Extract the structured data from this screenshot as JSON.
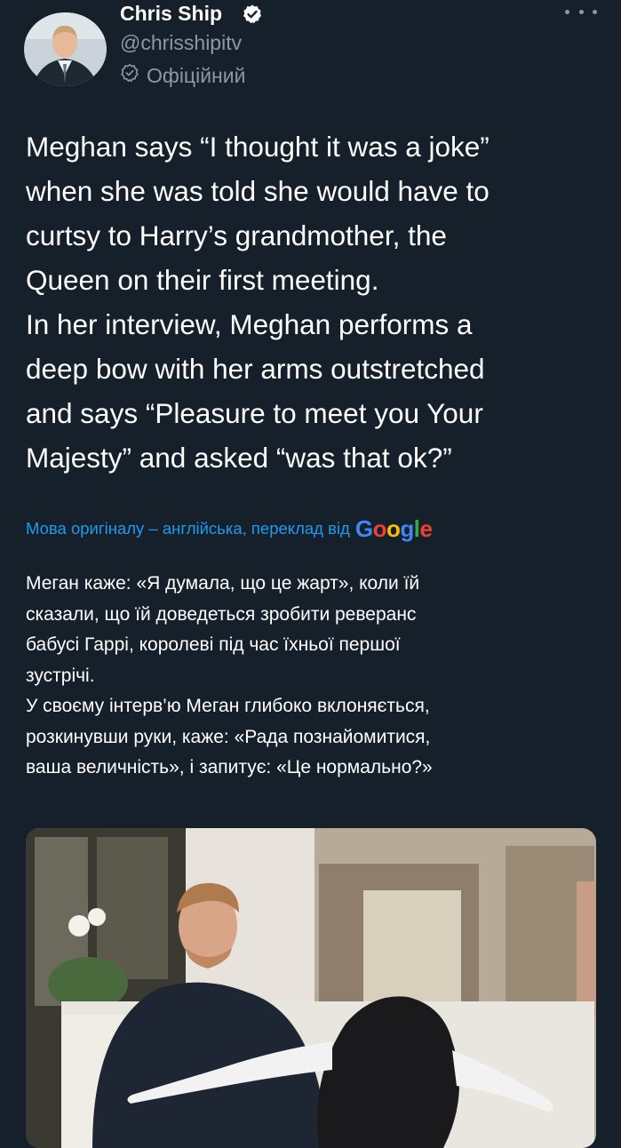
{
  "author": {
    "name": "Chris Ship",
    "handle": "@chrisshipitv",
    "official_label": "Офіційний",
    "verified_icon": "verified-badge-icon"
  },
  "tweet": {
    "lines": [
      "Meghan says “I thought it was a joke”",
      "when she was told she would have to",
      "curtsy to Harry’s grandmother, the",
      "Queen on their first meeting.",
      "In her interview, Meghan performs a",
      "deep bow with her arms outstretched",
      "and says “Pleasure to meet you Your",
      "Majesty” and asked “was that ok?”"
    ]
  },
  "translation": {
    "source_text": "Мова оригіналу – англійська, переклад від",
    "provider": "Google",
    "lines": [
      "Меган каже: «Я думала, що це жарт», коли їй",
      "сказали, що їй доведеться зробити реверанс",
      "бабусі Гаррі, королеві під час їхньої першої",
      "зустрічі.",
      "У своєму інтерв’ю Меган глибоко вклоняється,",
      "розкинувши руки, каже: «Рада познайомитися,",
      "ваша величність», і запитує: «Це нормально?»"
    ]
  },
  "colors": {
    "background": "#15202b",
    "secondary_text": "#8b98a5",
    "link": "#1d9bf0",
    "verified": "#ffffff"
  }
}
